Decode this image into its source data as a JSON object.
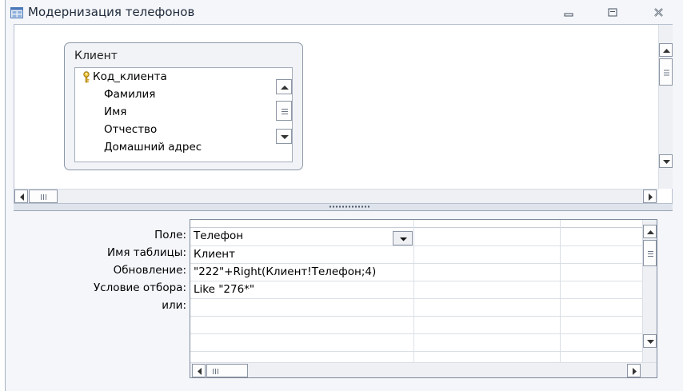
{
  "window": {
    "title": "Модернизация телефонов",
    "icon": "query-icon",
    "controls": [
      "minimize-icon",
      "restore-icon",
      "close-icon"
    ]
  },
  "table_box": {
    "title": "Клиент",
    "fields": [
      {
        "label": "Код_клиента",
        "primary_key": true
      },
      {
        "label": "Фамилия",
        "primary_key": false
      },
      {
        "label": "Имя",
        "primary_key": false
      },
      {
        "label": "Отчество",
        "primary_key": false
      },
      {
        "label": "Домашний адрес",
        "primary_key": false
      }
    ]
  },
  "grid": {
    "row_labels": {
      "field": "Поле:",
      "table": "Имя таблицы:",
      "update": "Обновление:",
      "criteria": "Условие отбора:",
      "or": "или:"
    },
    "column1": {
      "field": "Телефон",
      "table": "Клиент",
      "update": "\"222\"+Right(Клиент!Телефон;4)",
      "criteria": "Like \"276*\""
    }
  }
}
